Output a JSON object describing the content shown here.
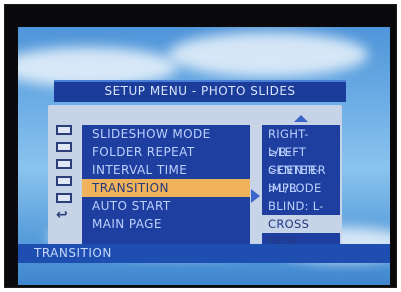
{
  "title": "SETUP MENU - PHOTO SLIDES",
  "menu": [
    {
      "label": "SLIDESHOW MODE",
      "icon": "slideshow-icon"
    },
    {
      "label": "FOLDER REPEAT",
      "icon": "folder-repeat-icon"
    },
    {
      "label": "INTERVAL TIME",
      "icon": "interval-icon"
    },
    {
      "label": "TRANSITION",
      "icon": "transition-icon"
    },
    {
      "label": "AUTO START",
      "icon": "auto-start-icon"
    },
    {
      "label": "MAIN PAGE",
      "icon": "return-icon"
    }
  ],
  "selected_menu": "TRANSITION",
  "options": [
    "RIGHT->LEFT",
    "L/R->CENTER",
    "CENTER->L/R",
    "IMPLODE",
    "BLIND: L->R",
    "CROSS FADE"
  ],
  "selected_option": "CROSS FADE",
  "status": "TRANSITION",
  "colors": {
    "menu_bg": "#1e3f9f",
    "highlight": "#f0b25a",
    "option_highlight": "#c7d3e6",
    "sky": "#5a9fdc"
  }
}
